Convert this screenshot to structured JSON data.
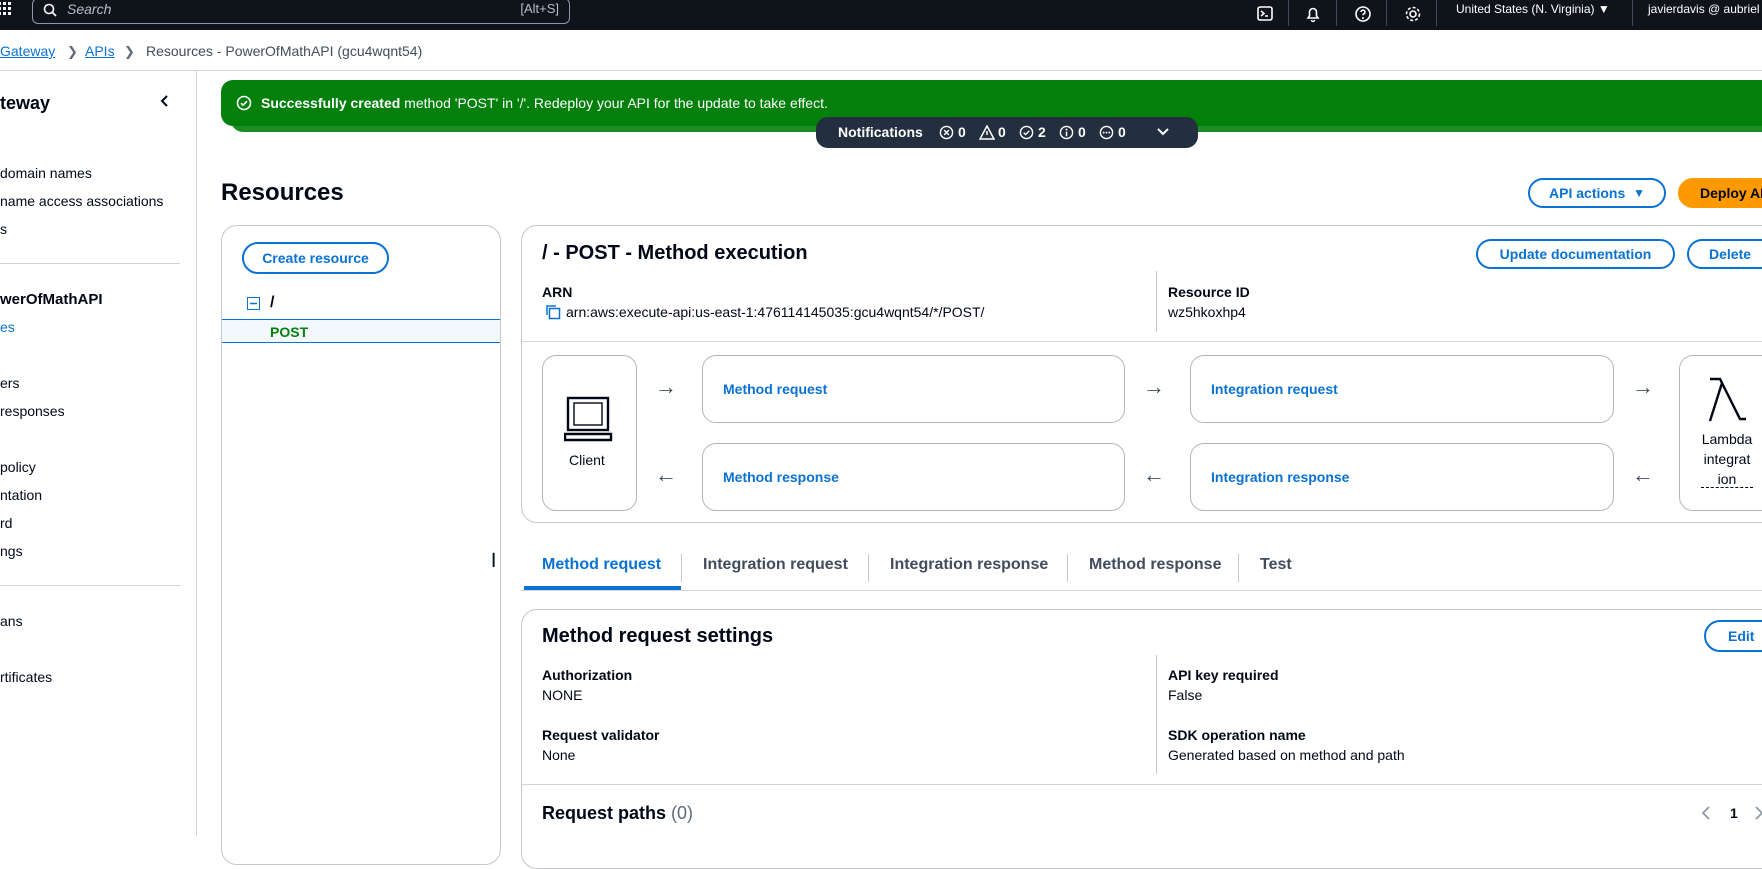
{
  "topnav": {
    "search_placeholder": "Search",
    "search_shortcut": "[Alt+S]",
    "region": "United States (N. Virginia) ▼",
    "user": "javierdavis @ aubriel"
  },
  "breadcrumb": {
    "items": [
      "Gateway",
      "APIs"
    ],
    "current": "Resources - PowerOfMathAPI (gcu4wqnt54)"
  },
  "sidebar": {
    "title": "teway",
    "items": [
      "domain names",
      "name access associations",
      "s"
    ],
    "api_name": "werOfMathAPI",
    "api_items": [
      "es",
      "ers",
      " responses",
      " policy",
      "ntation",
      "rd",
      "ngs"
    ],
    "bottom_items": [
      "ans",
      "rtificates"
    ]
  },
  "flash": {
    "bold": "Successfully created",
    "message": " method 'POST' in '/'. Redeploy your API for the update to take effect."
  },
  "notifications": {
    "label": "Notifications",
    "errors": "0",
    "warnings": "0",
    "success": "2",
    "info": "0",
    "in_progress": "0"
  },
  "page": {
    "title": "Resources",
    "api_actions": "API actions",
    "deploy": "Deploy API"
  },
  "tree": {
    "create_resource": "Create resource",
    "root": "/",
    "method": "POST"
  },
  "method": {
    "title": "/ - POST - Method execution",
    "update_doc": "Update documentation",
    "delete": "Delete",
    "arn_label": "ARN",
    "arn_value": "arn:aws:execute-api:us-east-1:476114145035:gcu4wqnt54/*/POST/",
    "resource_id_label": "Resource ID",
    "resource_id_value": "wz5hkoxhp4"
  },
  "flow": {
    "client": "Client",
    "method_request": "Method request",
    "integration_request": "Integration request",
    "method_response": "Method response",
    "integration_response": "Integration response",
    "lambda_line1": "Lambda",
    "lambda_line2": "integrat",
    "lambda_line3": "ion"
  },
  "tabs": [
    "Method request",
    "Integration request",
    "Integration response",
    "Method response",
    "Test"
  ],
  "settings": {
    "title": "Method request settings",
    "edit": "Edit",
    "authorization_label": "Authorization",
    "authorization_value": "NONE",
    "api_key_label": "API key required",
    "api_key_value": "False",
    "validator_label": "Request validator",
    "validator_value": "None",
    "sdk_label": "SDK operation name",
    "sdk_value": "Generated based on method and path",
    "request_paths_label": "Request paths",
    "request_paths_count": "(0)",
    "page_number": "1"
  },
  "colors": {
    "accent": "#0972d3",
    "success": "#037f0c",
    "primary": "#ff9900",
    "nav_bg": "#0f141a"
  }
}
